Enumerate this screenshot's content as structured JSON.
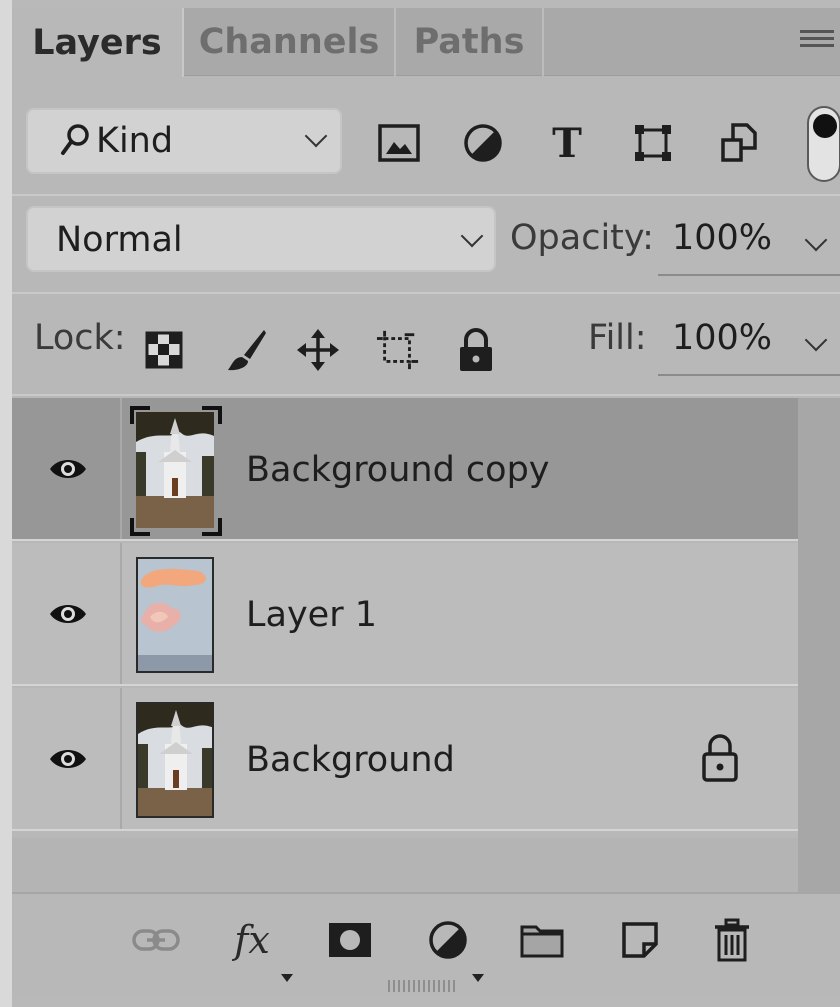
{
  "tabs": [
    {
      "label": "Layers",
      "active": true
    },
    {
      "label": "Channels",
      "active": false
    },
    {
      "label": "Paths",
      "active": false
    }
  ],
  "panel_menu_icon": "hamburger-menu-icon",
  "filter": {
    "kind_label": "Kind",
    "icons": [
      "image-filter-icon",
      "adjustment-filter-icon",
      "type-filter-icon",
      "shape-filter-icon",
      "smart-object-filter-icon"
    ],
    "type_glyph": "T",
    "toggle_on": true
  },
  "blend": {
    "mode": "Normal",
    "opacity_label": "Opacity:",
    "opacity_value": "100%"
  },
  "lock": {
    "label": "Lock:",
    "icons": [
      "lock-transparent-pixels-icon",
      "lock-image-pixels-icon",
      "lock-position-icon",
      "lock-artboard-icon",
      "lock-all-icon"
    ],
    "fill_label": "Fill:",
    "fill_value": "100%"
  },
  "layers": [
    {
      "name": "Background copy",
      "visible": true,
      "selected": true,
      "locked": false,
      "thumb": "church"
    },
    {
      "name": "Layer 1",
      "visible": true,
      "selected": false,
      "locked": false,
      "thumb": "clouds"
    },
    {
      "name": "Background",
      "visible": true,
      "selected": false,
      "locked": true,
      "thumb": "church"
    }
  ],
  "bottom_toolbar": {
    "fx_label": "fx",
    "icons": [
      "link-layers-icon",
      "layer-style-icon",
      "layer-mask-icon",
      "adjustment-layer-icon",
      "group-folder-icon",
      "new-layer-icon",
      "trash-icon"
    ]
  },
  "colors": {
    "panel_bg": "#b8b8b8",
    "selected_row": "#979797",
    "tab_inactive": "#a9a9a9"
  }
}
